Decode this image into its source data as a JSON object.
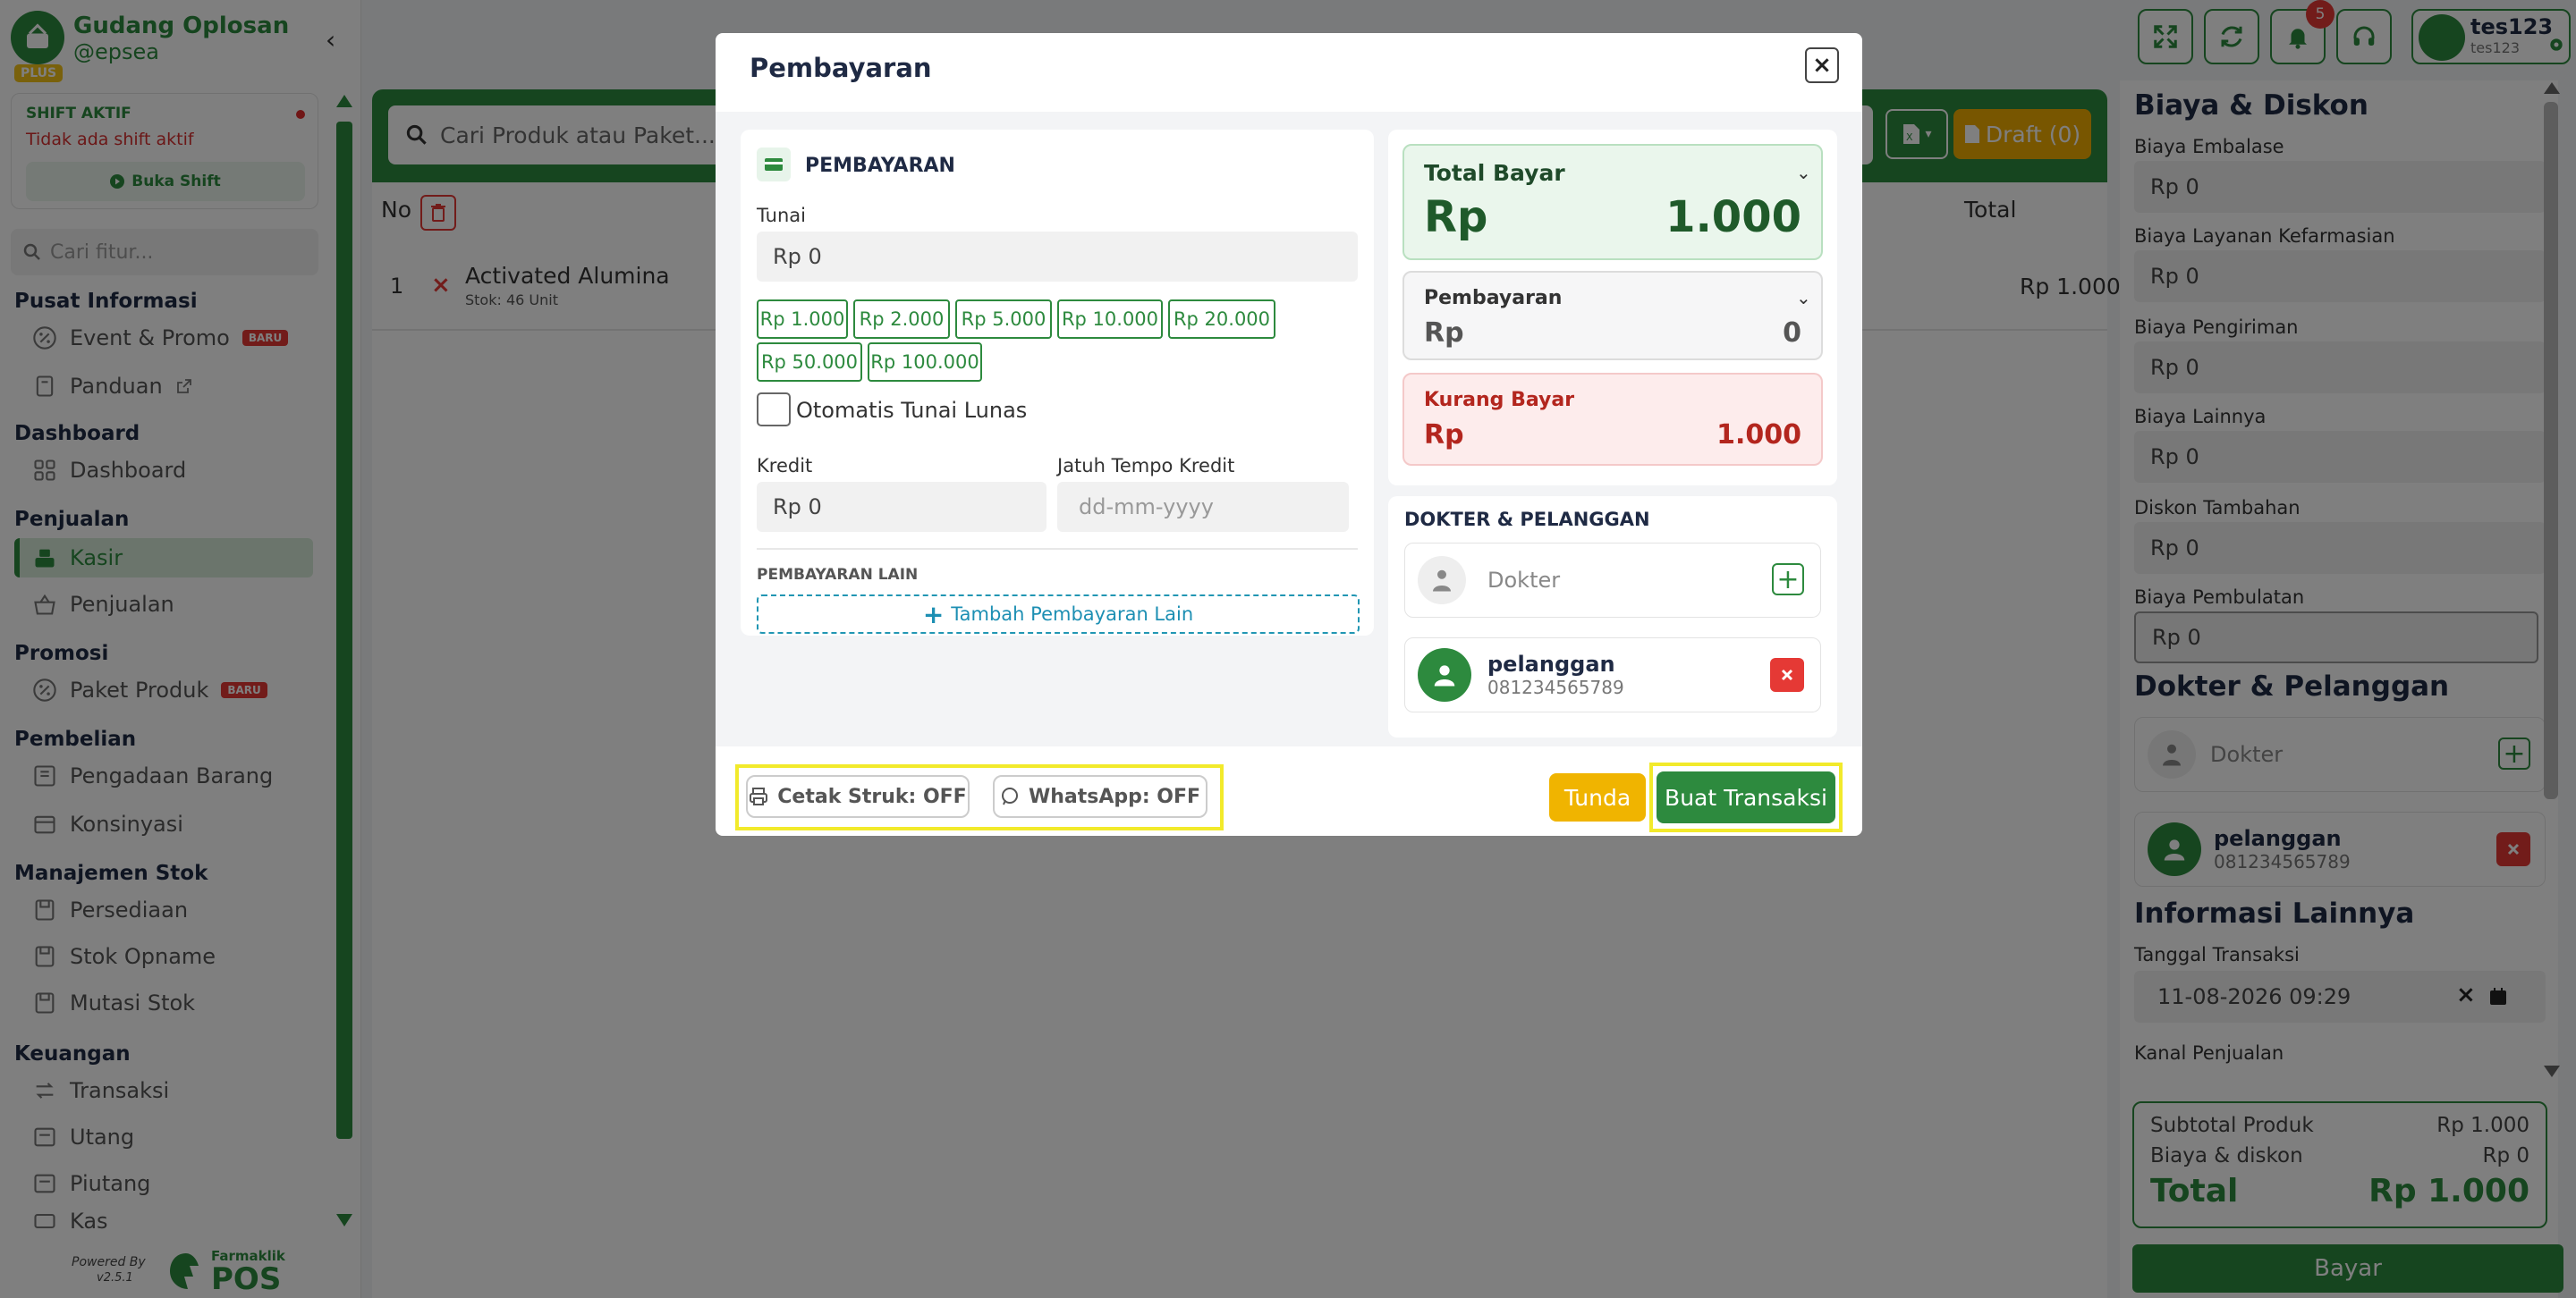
{
  "brand": {
    "name": "Gudang Oplosan",
    "handle": "@epsea",
    "badge": "PLUS"
  },
  "shift": {
    "title": "SHIFT AKTIF",
    "message": "Tidak ada shift aktif",
    "button": "Buka Shift"
  },
  "side_search_placeholder": "Cari fitur...",
  "sidebar": [
    {
      "section": "Pusat Informasi",
      "items": [
        {
          "label": "Event & Promo",
          "badge": "BARU",
          "icon": "percent-icon"
        },
        {
          "label": "Panduan",
          "icon": "book-icon",
          "external": true
        }
      ]
    },
    {
      "section": "Dashboard",
      "items": [
        {
          "label": "Dashboard",
          "icon": "grid-icon"
        }
      ]
    },
    {
      "section": "Penjualan",
      "items": [
        {
          "label": "Kasir",
          "icon": "cashier-icon",
          "active": true
        },
        {
          "label": "Penjualan",
          "icon": "basket-icon"
        }
      ]
    },
    {
      "section": "Promosi",
      "items": [
        {
          "label": "Paket Produk",
          "badge": "BARU",
          "icon": "percent-icon"
        }
      ]
    },
    {
      "section": "Pembelian",
      "items": [
        {
          "label": "Pengadaan Barang",
          "icon": "procure-icon"
        },
        {
          "label": "Konsinyasi",
          "icon": "box-icon"
        }
      ]
    },
    {
      "section": "Manajemen Stok",
      "items": [
        {
          "label": "Persediaan",
          "icon": "save-icon"
        },
        {
          "label": "Stok Opname",
          "icon": "save-icon"
        },
        {
          "label": "Mutasi Stok",
          "icon": "save-icon"
        }
      ]
    },
    {
      "section": "Keuangan",
      "items": [
        {
          "label": "Transaksi",
          "icon": "transfer-icon"
        },
        {
          "label": "Utang",
          "icon": "list-icon"
        },
        {
          "label": "Piutang",
          "icon": "list-icon"
        },
        {
          "label": "Kas",
          "icon": "cash-icon"
        }
      ]
    }
  ],
  "powered": {
    "text": "Powered By",
    "version": "v2.5.1",
    "logo_top": "Farmaklik",
    "logo_bottom": "POS"
  },
  "topbar": {
    "notif_count": "5",
    "user_name": "tes123",
    "user_sub": "tes123"
  },
  "main": {
    "search_placeholder": "Cari Produk atau Paket...",
    "draft_label": "Draft (0)",
    "col_no": "No",
    "col_total": "Total",
    "rows": [
      {
        "no": "1",
        "name": "Activated Alumina",
        "stock": "Stok: 46 Unit",
        "total": "Rp 1.000"
      }
    ]
  },
  "right": {
    "biaya_title": "Biaya & Diskon",
    "fields": [
      {
        "label": "Biaya Embalase",
        "value": "Rp 0"
      },
      {
        "label": "Biaya Layanan Kefarmasian",
        "value": "Rp 0"
      },
      {
        "label": "Biaya Pengiriman",
        "value": "Rp 0"
      },
      {
        "label": "Biaya Lainnya",
        "value": "Rp 0"
      },
      {
        "label": "Diskon Tambahan",
        "value": "Rp 0"
      },
      {
        "label": "Biaya Pembulatan",
        "value": "Rp 0"
      }
    ],
    "dokter_title": "Dokter & Pelanggan",
    "dokter_placeholder": "Dokter",
    "customer_name": "pelanggan",
    "customer_phone": "081234565789",
    "info_title": "Informasi Lainnya",
    "tanggal_label": "Tanggal Transaksi",
    "tanggal_value": "11-08-2026 09:29",
    "kanal_label": "Kanal Penjualan",
    "summary": {
      "subtotal_label": "Subtotal Produk",
      "subtotal_value": "Rp 1.000",
      "biaya_label": "Biaya & diskon",
      "biaya_value": "Rp 0",
      "total_label": "Total",
      "total_value": "Rp 1.000"
    },
    "bayar_label": "Bayar"
  },
  "modal": {
    "title": "Pembayaran",
    "close": "×",
    "pay_section": "PEMBAYARAN",
    "tunai_label": "Tunai",
    "tunai_value": "Rp 0",
    "chips": [
      "Rp 1.000",
      "Rp 2.000",
      "Rp 5.000",
      "Rp 10.000",
      "Rp 20.000",
      "Rp 50.000",
      "Rp 100.000"
    ],
    "auto_lunas": "Otomatis Tunai Lunas",
    "kredit_label": "Kredit",
    "kredit_value": "Rp 0",
    "jatuh_tempo_label": "Jatuh Tempo Kredit",
    "jatuh_tempo_placeholder": "dd-mm-yyyy",
    "pembayaran_lain": "PEMBAYARAN LAIN",
    "tambah_lain": "Tambah Pembayaran Lain",
    "total_bayar_label": "Total Bayar",
    "total_bayar_currency": "Rp",
    "total_bayar_value": "1.000",
    "pembayaran_label": "Pembayaran",
    "pembayaran_currency": "Rp",
    "pembayaran_value": "0",
    "kurang_label": "Kurang Bayar",
    "kurang_currency": "Rp",
    "kurang_value": "1.000",
    "dokter_section": "DOKTER & PELANGGAN",
    "dokter_placeholder": "Dokter",
    "customer_name": "pelanggan",
    "customer_phone": "081234565789",
    "cetak_label": "Cetak Struk: OFF",
    "wa_label": "WhatsApp: OFF",
    "tunda_label": "Tunda",
    "buat_label": "Buat Transaksi"
  },
  "colors": {
    "primary": "#2d8a3e",
    "warning": "#f0ad00",
    "danger": "#e53935",
    "highlight": "#f2ea2b"
  }
}
